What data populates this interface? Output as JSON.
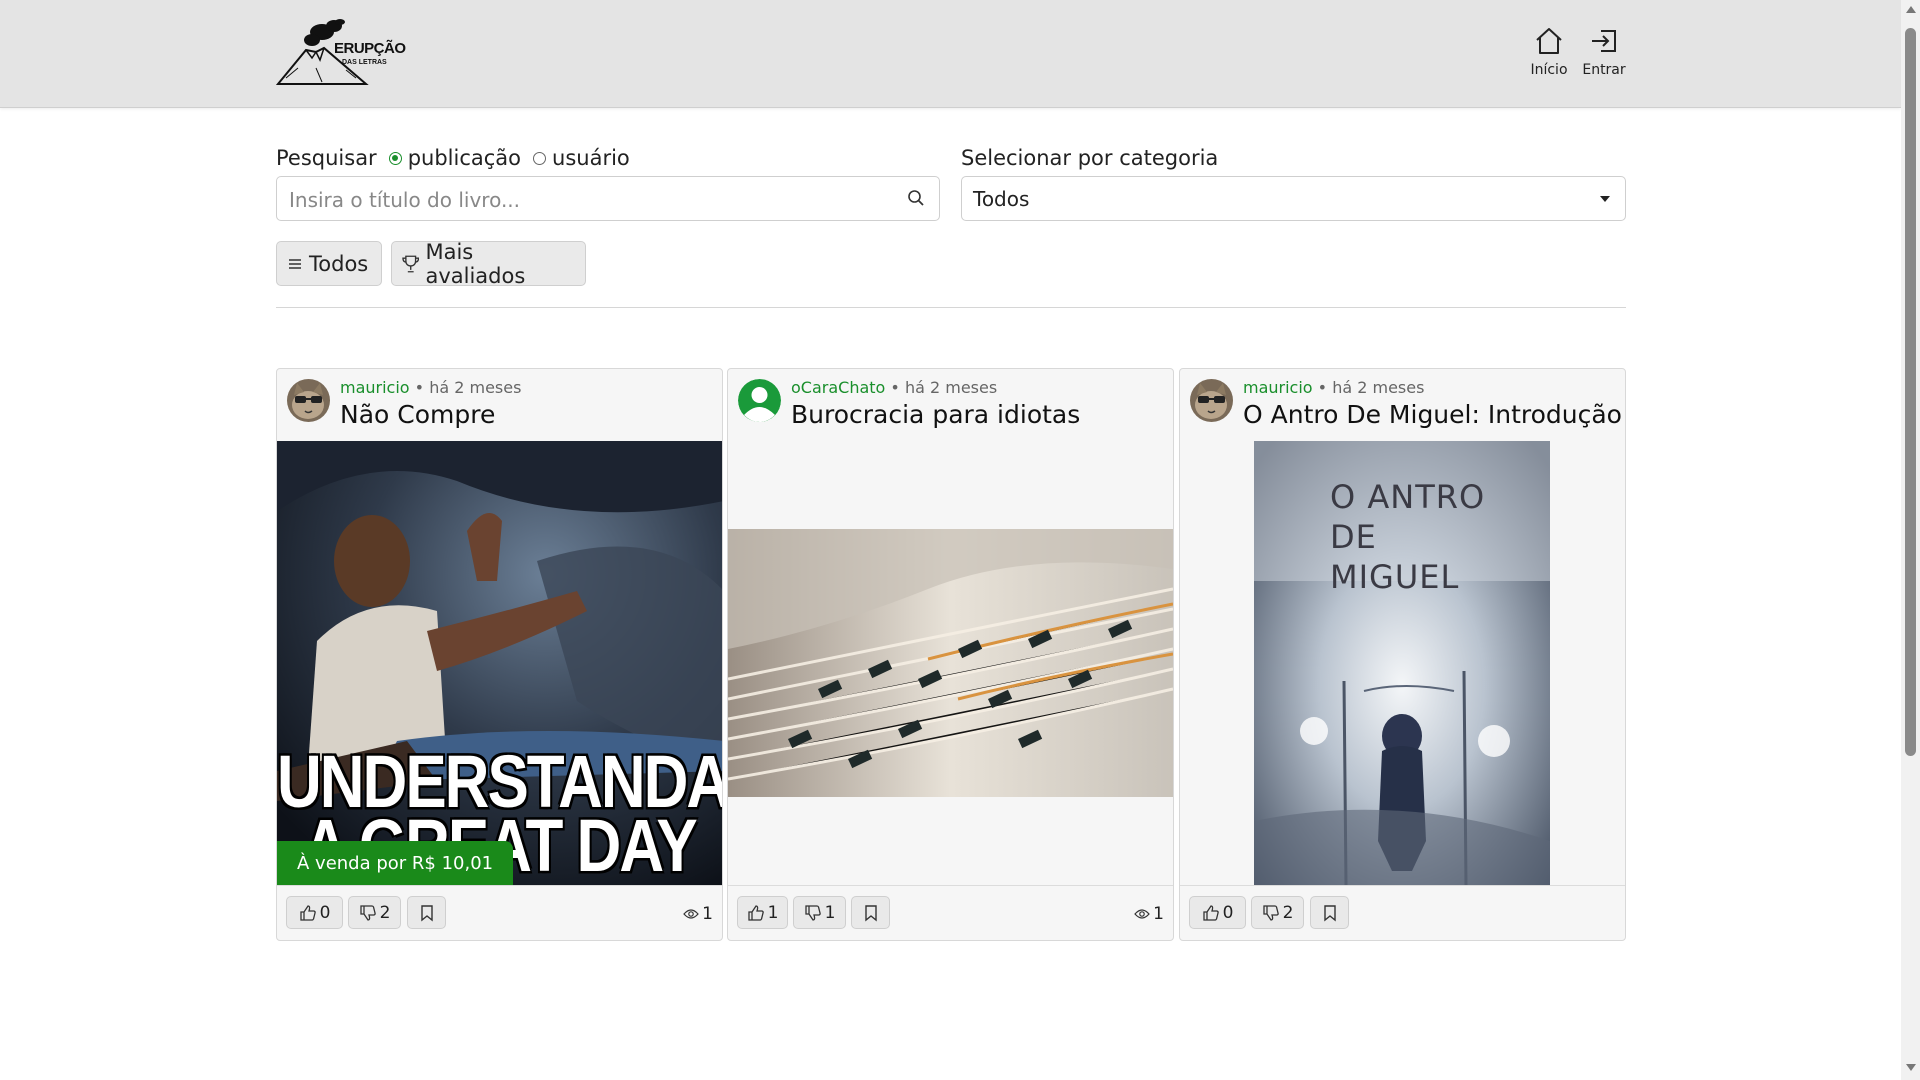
{
  "header": {
    "logo_title": "ERUPÇÃO",
    "logo_subtitle": "DAS LETRAS",
    "nav": [
      {
        "label": "Início",
        "icon": "home-icon"
      },
      {
        "label": "Entrar",
        "icon": "login-icon"
      }
    ]
  },
  "search": {
    "label": "Pesquisar",
    "options": [
      {
        "label": "publicação",
        "selected": true
      },
      {
        "label": "usuário",
        "selected": false
      }
    ],
    "placeholder": "Insira o título do livro...",
    "value": ""
  },
  "category": {
    "label": "Selecionar por categoria",
    "selected": "Todos"
  },
  "filters": {
    "todos": "Todos",
    "mais_avaliados": "Mais avaliados"
  },
  "posts": [
    {
      "user": "mauricio",
      "separator": " • ",
      "time": "há 2 meses",
      "title": "Não Compre",
      "image_caption": [
        "UNDERSTANDABLE",
        "A GREAT DAY"
      ],
      "sale": "À venda por R$ 10,01",
      "likes": "0",
      "dislikes": "2",
      "views": "1"
    },
    {
      "user": "oCaraChato",
      "separator": " • ",
      "time": "há 2 meses",
      "title": "Burocracia para idiotas",
      "likes": "1",
      "dislikes": "1",
      "views": "1"
    },
    {
      "user": "mauricio",
      "separator": " • ",
      "time": "há 2 meses",
      "title": "O Antro De Miguel: Introdução",
      "cover_text": [
        "O ANTRO",
        "DE",
        "MIGUEL"
      ],
      "likes": "0",
      "dislikes": "2"
    }
  ],
  "colors": {
    "accent": "#1a8f2c",
    "sale_badge": "#1a8a1a",
    "header_bg": "#e4e4e4"
  }
}
